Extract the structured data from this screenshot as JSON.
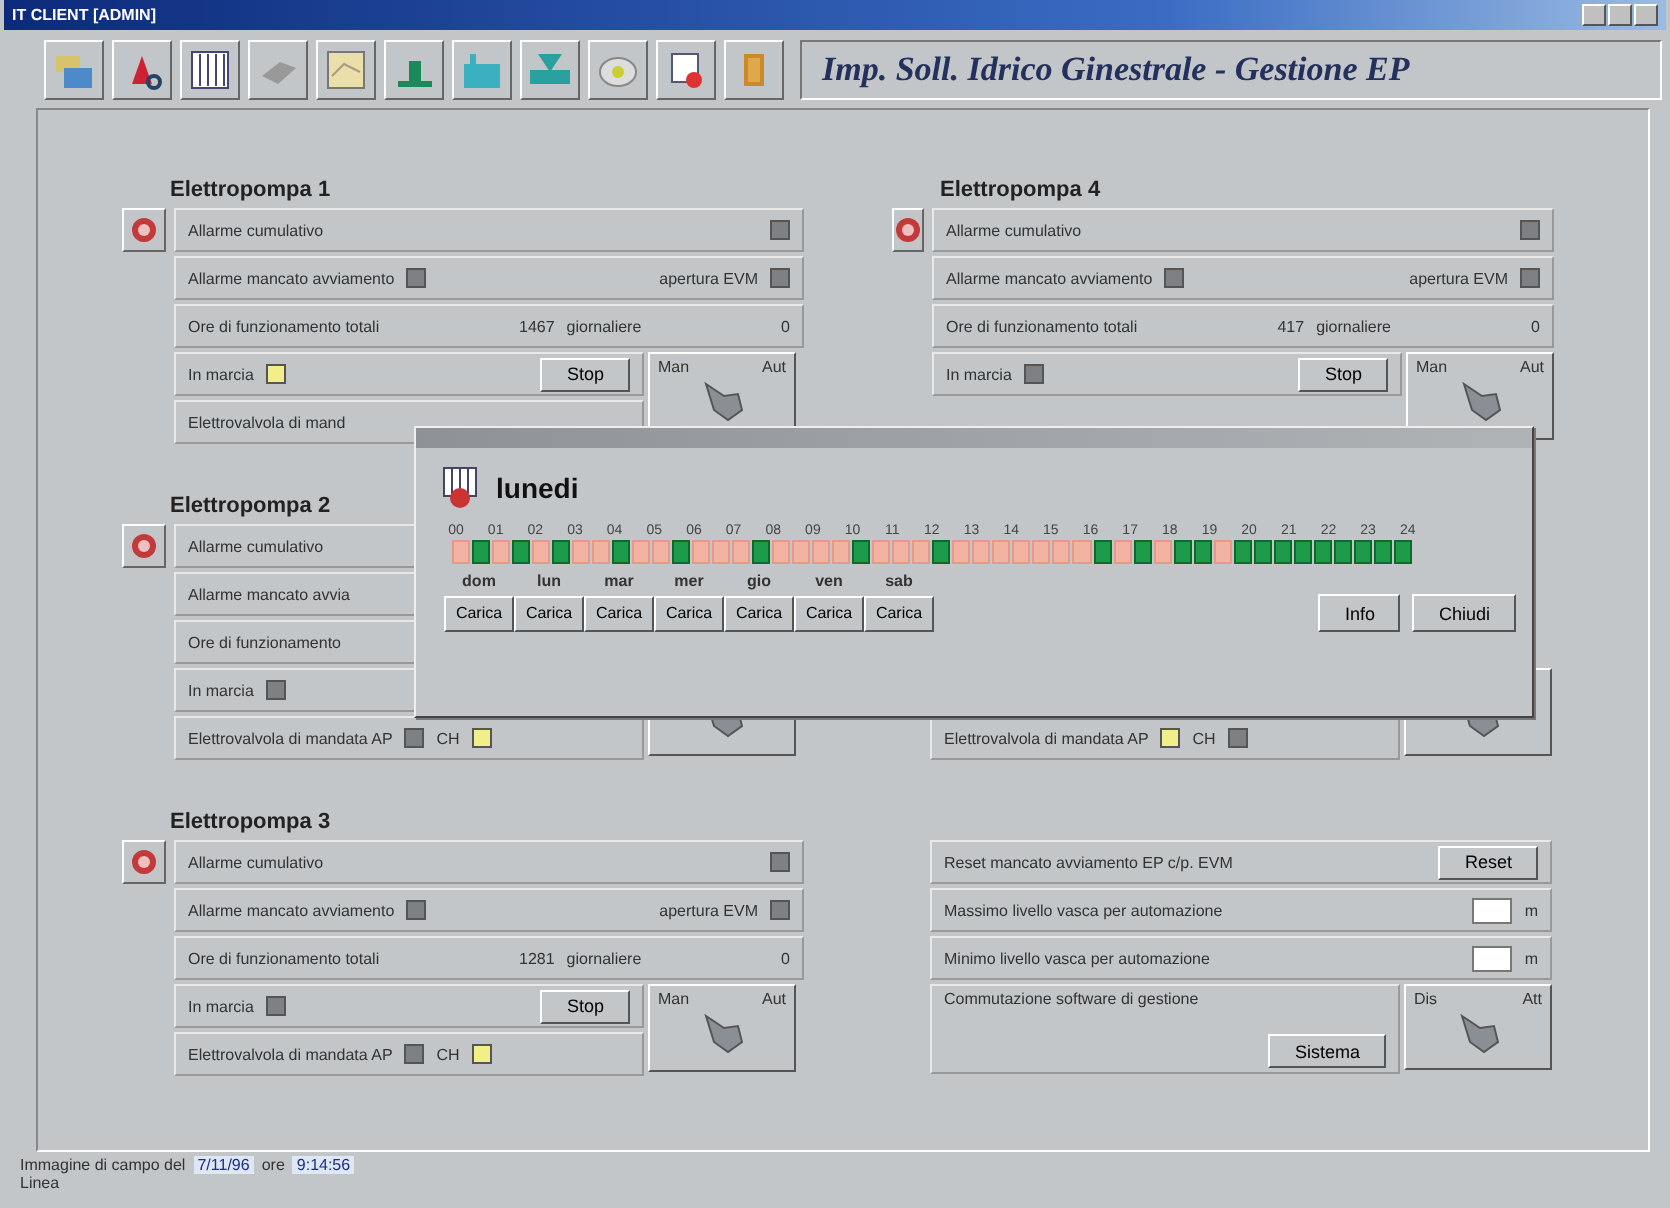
{
  "window": {
    "title": "IT CLIENT [ADMIN]"
  },
  "toolbar": {
    "title": "Imp. Soll. Idrico Ginestrale - Gestione EP"
  },
  "panels": [
    {
      "title": "Elettropompa 1",
      "alarm": {
        "label": "Allarme cumulativo",
        "on": false
      },
      "missed": {
        "label": "Allarme mancato avviamento",
        "on": false,
        "label2": "apertura EVM",
        "on2": false
      },
      "hours": {
        "label": "Ore di funzionamento totali",
        "value": "1467",
        "label2": "giornaliere",
        "value2": "0"
      },
      "running": {
        "label": "In marcia",
        "on": true,
        "button": "Stop"
      },
      "valve": {
        "label": "Elettrovalvola di mand"
      },
      "selector": {
        "left": "Man",
        "right": "Aut"
      }
    },
    {
      "title": "Elettropompa 4",
      "alarm": {
        "label": "Allarme cumulativo",
        "on": false
      },
      "missed": {
        "label": "Allarme mancato avviamento",
        "on": false,
        "label2": "apertura EVM",
        "on2": false
      },
      "hours": {
        "label": "Ore di funzionamento totali",
        "value": "417",
        "label2": "giornaliere",
        "value2": "0"
      },
      "running": {
        "label": "In marcia",
        "on": false,
        "button": "Stop"
      },
      "selector": {
        "left": "Man",
        "right": "Aut"
      }
    },
    {
      "title": "Elettropompa 2",
      "alarm": {
        "label": "Allarme cumulativo"
      },
      "missed": {
        "label": "Allarme mancato avvia"
      },
      "hours": {
        "label": "Ore di funzionamento"
      },
      "running": {
        "label": "In marcia",
        "on": false
      },
      "valve": {
        "label": "Elettrovalvola di mandata AP",
        "ap_on": false,
        "ch_label": "CH",
        "ch_on": true
      }
    },
    {
      "valve": {
        "label": "Elettrovalvola di mandata AP",
        "ap_on": true,
        "ch_label": "CH",
        "ch_on": false
      }
    },
    {
      "title": "Elettropompa 3",
      "alarm": {
        "label": "Allarme cumulativo",
        "on": false
      },
      "missed": {
        "label": "Allarme mancato avviamento",
        "on": false,
        "label2": "apertura EVM",
        "on2": false
      },
      "hours": {
        "label": "Ore di funzionamento totali",
        "value": "1281",
        "label2": "giornaliere",
        "value2": "0"
      },
      "running": {
        "label": "In marcia",
        "on": false,
        "button": "Stop"
      },
      "valve": {
        "label": "Elettrovalvola di mandata AP",
        "ap_on": false,
        "ch_label": "CH",
        "ch_on": true
      },
      "selector": {
        "left": "Man",
        "right": "Aut"
      }
    }
  ],
  "settings": {
    "reset": {
      "label": "Reset mancato avviamento EP c/p. EVM",
      "button": "Reset"
    },
    "levels": [
      {
        "label": "Massimo livello vasca per automazione",
        "unit": "m"
      },
      {
        "label": "Minimo livello vasca per automazione",
        "unit": "m"
      }
    ],
    "software": {
      "label": "Commutazione software di gestione",
      "button": "Sistema",
      "left": "Dis",
      "right": "Att"
    }
  },
  "dialog": {
    "day": "lunedi",
    "hours": [
      "00",
      "01",
      "02",
      "03",
      "04",
      "05",
      "06",
      "07",
      "08",
      "09",
      "10",
      "11",
      "12",
      "13",
      "14",
      "15",
      "16",
      "17",
      "18",
      "19",
      "20",
      "21",
      "22",
      "23",
      "24"
    ],
    "slots": [
      false,
      true,
      false,
      true,
      false,
      true,
      false,
      false,
      true,
      false,
      false,
      true,
      false,
      false,
      false,
      true,
      false,
      false,
      false,
      false,
      true,
      false,
      false,
      false,
      true,
      false,
      false,
      false,
      false,
      false,
      false,
      false,
      true,
      false,
      true,
      false,
      true,
      true,
      false,
      true,
      true,
      true,
      true,
      true,
      true,
      true,
      true,
      true
    ],
    "days": [
      {
        "label": "dom",
        "button": "Carica"
      },
      {
        "label": "lun",
        "button": "Carica"
      },
      {
        "label": "mar",
        "button": "Carica"
      },
      {
        "label": "mer",
        "button": "Carica"
      },
      {
        "label": "gio",
        "button": "Carica"
      },
      {
        "label": "ven",
        "button": "Carica"
      },
      {
        "label": "sab",
        "button": "Carica"
      }
    ],
    "info_button": "Info",
    "close_button": "Chiudi"
  },
  "status_bar": {
    "label": "Immagine di campo del",
    "date": "7/11/96",
    "label2": "ore",
    "time": "9:14:56",
    "line2": "Linea"
  }
}
